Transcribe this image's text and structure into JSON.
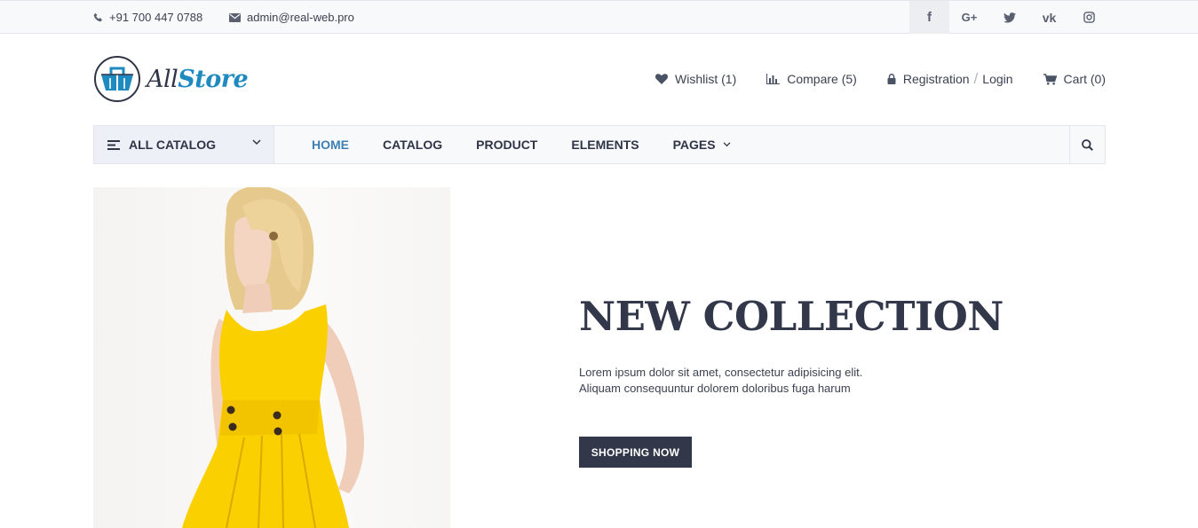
{
  "topbar": {
    "phone": "+91 700 447 0788",
    "email": "admin@real-web.pro",
    "socials": [
      {
        "icon": "facebook-icon",
        "glyph": "f"
      },
      {
        "icon": "google-plus-icon",
        "glyph": "G+"
      },
      {
        "icon": "twitter-icon",
        "glyph": ""
      },
      {
        "icon": "vk-icon",
        "glyph": "vk"
      },
      {
        "icon": "instagram-icon",
        "glyph": ""
      }
    ]
  },
  "brand": {
    "part1": "All",
    "part2": "Store",
    "accent_color": "#1f8ac0"
  },
  "header": {
    "wishlist": "Wishlist (1)",
    "compare": "Compare (5)",
    "registration": "Registration",
    "separator": "/",
    "login": "Login",
    "cart": "Cart (0)"
  },
  "nav": {
    "catalog": "ALL CATALOG",
    "items": [
      "HOME",
      "CATALOG",
      "PRODUCT",
      "ELEMENTS",
      "PAGES"
    ],
    "active_color": "#3d7fb3"
  },
  "hero": {
    "title": "NEW COLLECTION",
    "line1": "Lorem ipsum dolor sit amet, consectetur adipisicing elit.",
    "line2": "Aliquam consequuntur dolorem doloribus fuga harum",
    "button": "SHOPPING NOW",
    "dark_color": "#323849"
  }
}
